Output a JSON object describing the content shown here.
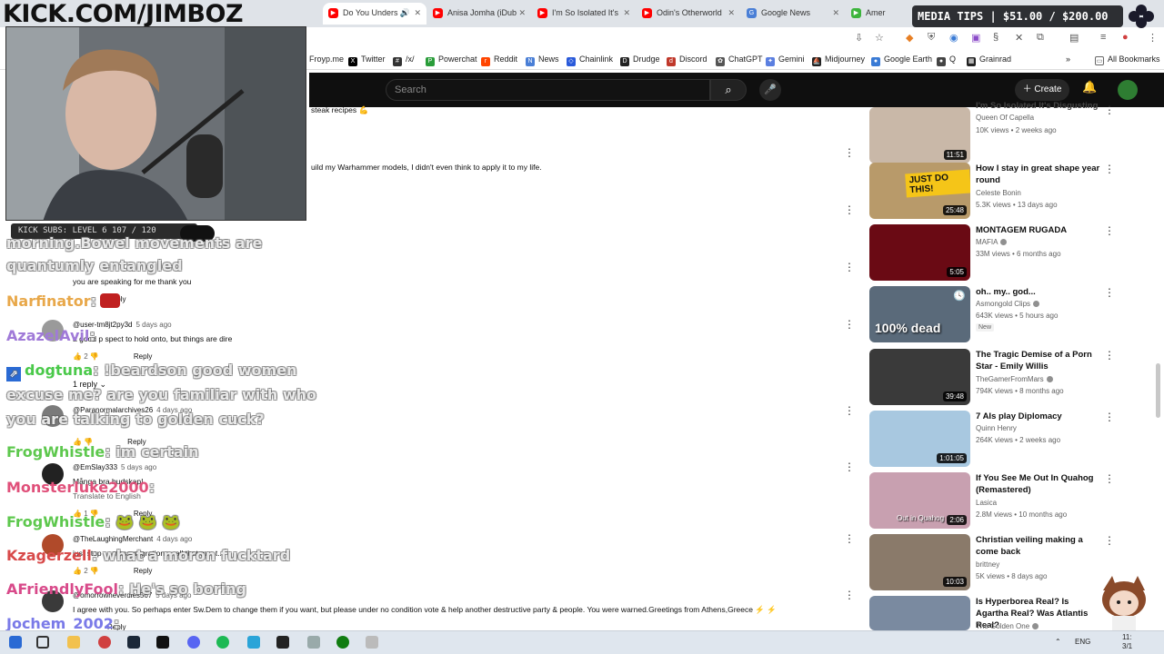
{
  "stream": {
    "brand": "KICK.COM/JIMBOZ",
    "subs_bar": "KICK SUBS: LEVEL 6 107 / 120",
    "media_tips": "MEDIA TIPS | $51.00 / $200.00"
  },
  "tabs": [
    {
      "label": "Do You Unders",
      "color": "#ff0000"
    },
    {
      "label": "Anisa Jomha (iDub",
      "color": "#ff0000"
    },
    {
      "label": "I'm So Isolated It's",
      "color": "#ff0000"
    },
    {
      "label": "Odin's Otherworld",
      "color": "#ff0000"
    },
    {
      "label": "Google News",
      "color": "#4a7fd6"
    },
    {
      "label": "Amer",
      "color": "#3cb43c"
    }
  ],
  "bookmarks": [
    {
      "label": "Froyp.me",
      "color": "#888888"
    },
    {
      "label": "Twitter",
      "color": "#000000"
    },
    {
      "label": "/x/",
      "color": "#333333"
    },
    {
      "label": "Powerchat",
      "color": "#2a9d3a"
    },
    {
      "label": "Reddit",
      "color": "#ff4500"
    },
    {
      "label": "News",
      "color": "#4a7fd6"
    },
    {
      "label": "Chainlink",
      "color": "#2a5ada"
    },
    {
      "label": "Drudge",
      "color": "#222222"
    },
    {
      "label": "Discord",
      "color": "#c0392b"
    },
    {
      "label": "ChatGPT",
      "color": "#555555"
    },
    {
      "label": "Gemini",
      "color": "#5b7fe0"
    },
    {
      "label": "Midjourney",
      "color": "#222222"
    },
    {
      "label": "Google Earth",
      "color": "#3a7bd5"
    },
    {
      "label": "Q",
      "color": "#444444"
    },
    {
      "label": "Grainrad",
      "color": "#222222"
    },
    {
      "label": "All Bookmarks",
      "color": "#666666"
    }
  ],
  "youtube": {
    "search_placeholder": "Search",
    "create_label": "Create"
  },
  "comments": [
    {
      "author": "",
      "age": "",
      "text": "steak recipes 💪"
    },
    {
      "author": "",
      "age": "",
      "text": "uild my Warhammer models, I didn't even think to apply it to my life."
    },
    {
      "author": "",
      "age": "",
      "text": "you are speaking for me thank you",
      "reply": "Reply"
    },
    {
      "author": "@user-tm8jt2py3d",
      "age": "5 days ago",
      "text": "a good p  spect  to hold onto, but things are dire",
      "likes": "2",
      "reply": "Reply",
      "replies": "1 reply"
    },
    {
      "author": "@Paranormalarchives26",
      "age": "4 days ago",
      "text": "",
      "reply": "Reply"
    },
    {
      "author": "@EmSlay333",
      "age": "5 days ago",
      "text": "Många bra budskap!",
      "translate": "Translate to English",
      "likes": "1",
      "reply": "Reply"
    },
    {
      "author": "@TheLaughingMerchant",
      "age": "4 days ago",
      "text": "just stop  ... mass migration ... all that m... t...",
      "likes": "2",
      "reply": "Reply"
    },
    {
      "author": "@omorrowneverdies567",
      "age": "5 days ago",
      "text": "I agree with you. So perhaps enter Sw.Dem to change them if you want, but please under no condition vote & help another destructive party & people. You were warned.Greetings from Athens,Greece ⚡ ⚡",
      "reply": "Reply"
    }
  ],
  "chat": [
    {
      "user": "",
      "msg": "morning.Bowel movements are",
      "color": "#ffffff"
    },
    {
      "user": "",
      "msg": "quantumly entangled",
      "color": "#ffffff"
    },
    {
      "user": "Narfinator",
      "msg": ":",
      "color": "#e8a84a"
    },
    {
      "user": "AzazelAvil",
      "msg": ":",
      "color": "#a07ad8"
    },
    {
      "user": "dogtuna",
      "msg": ": !beardson good women",
      "color": "#4ac94a"
    },
    {
      "user": "",
      "msg": "excuse me? are you familiar with who",
      "color": "#ffffff"
    },
    {
      "user": "",
      "msg": "you are talking to golden cuck?",
      "color": "#ffffff"
    },
    {
      "user": "FrogWhistle",
      "msg": ": im certain",
      "color": "#5ec84e"
    },
    {
      "user": "Monsterluke2000",
      "msg": ":",
      "color": "#e0507a"
    },
    {
      "user": "FrogWhistle",
      "msg": ": 🐸 🐸 🐸",
      "color": "#5ec84e"
    },
    {
      "user": "Kzagerzell",
      "msg": ": what a moron fucktard",
      "color": "#d84a4a"
    },
    {
      "user": "AFriendlyFool",
      "msg": ": He's so boring",
      "color": "#d84a8a"
    },
    {
      "user": "Jochem_2002",
      "msg": ":",
      "color": "#7a7ae8"
    }
  ],
  "sidebar": [
    {
      "title": "I'm So Isolated It's Disgusting",
      "channel": "Queen Of Capella",
      "meta": "10K views • 2 weeks ago",
      "duration": "11:51",
      "verified": false,
      "thumb": "#c9b8a8"
    },
    {
      "title": "How I stay in great shape year round",
      "channel": "Celeste Bonin",
      "meta": "5.3K views • 13 days ago",
      "duration": "25:48",
      "verified": false,
      "thumb": "#b89a6a",
      "thumb_text": "JUST DO THIS!"
    },
    {
      "title": "MONTAGEM RUGADA",
      "channel": "MAFIA",
      "meta": "33M views • 6 months ago",
      "duration": "5:05",
      "verified": true,
      "thumb": "#6a0a14"
    },
    {
      "title": "oh.. my.. god...",
      "channel": "Asmongold Clips",
      "meta": "643K views • 5 hours ago",
      "duration": "",
      "verified": true,
      "new": "New",
      "thumb": "#5a6a7a",
      "thumb_text": "100% dead"
    },
    {
      "title": "The Tragic Demise of a Porn Star - Emily Willis",
      "channel": "TheGamerFromMars",
      "meta": "794K views • 8 months ago",
      "duration": "39:48",
      "verified": true,
      "thumb": "#3a3a3a"
    },
    {
      "title": "7 AIs play Diplomacy",
      "channel": "Quinn Henry",
      "meta": "264K views • 2 weeks ago",
      "duration": "1:01:05",
      "verified": false,
      "thumb": "#a8c8e0"
    },
    {
      "title": "If You See Me Out In Quahog (Remastered)",
      "channel": "Lasica",
      "meta": "2.8M views • 10 months ago",
      "duration": "2:06",
      "verified": false,
      "thumb": "#c8a0b0",
      "thumb_text": "Out in Quahog"
    },
    {
      "title": "Christian veiling making a come back",
      "channel": "brittney",
      "meta": "5K views • 8 days ago",
      "duration": "10:03",
      "verified": false,
      "thumb": "#8a7a6a"
    },
    {
      "title": "Is Hyperborea Real? Is Agartha Real? Was Atlantis Real?",
      "channel": "The Golden One",
      "meta": "",
      "duration": "",
      "verified": true,
      "thumb": "#7a8aa0"
    }
  ],
  "taskbar": {
    "lang": "ENG",
    "time": "11:",
    "date": "3/1"
  }
}
